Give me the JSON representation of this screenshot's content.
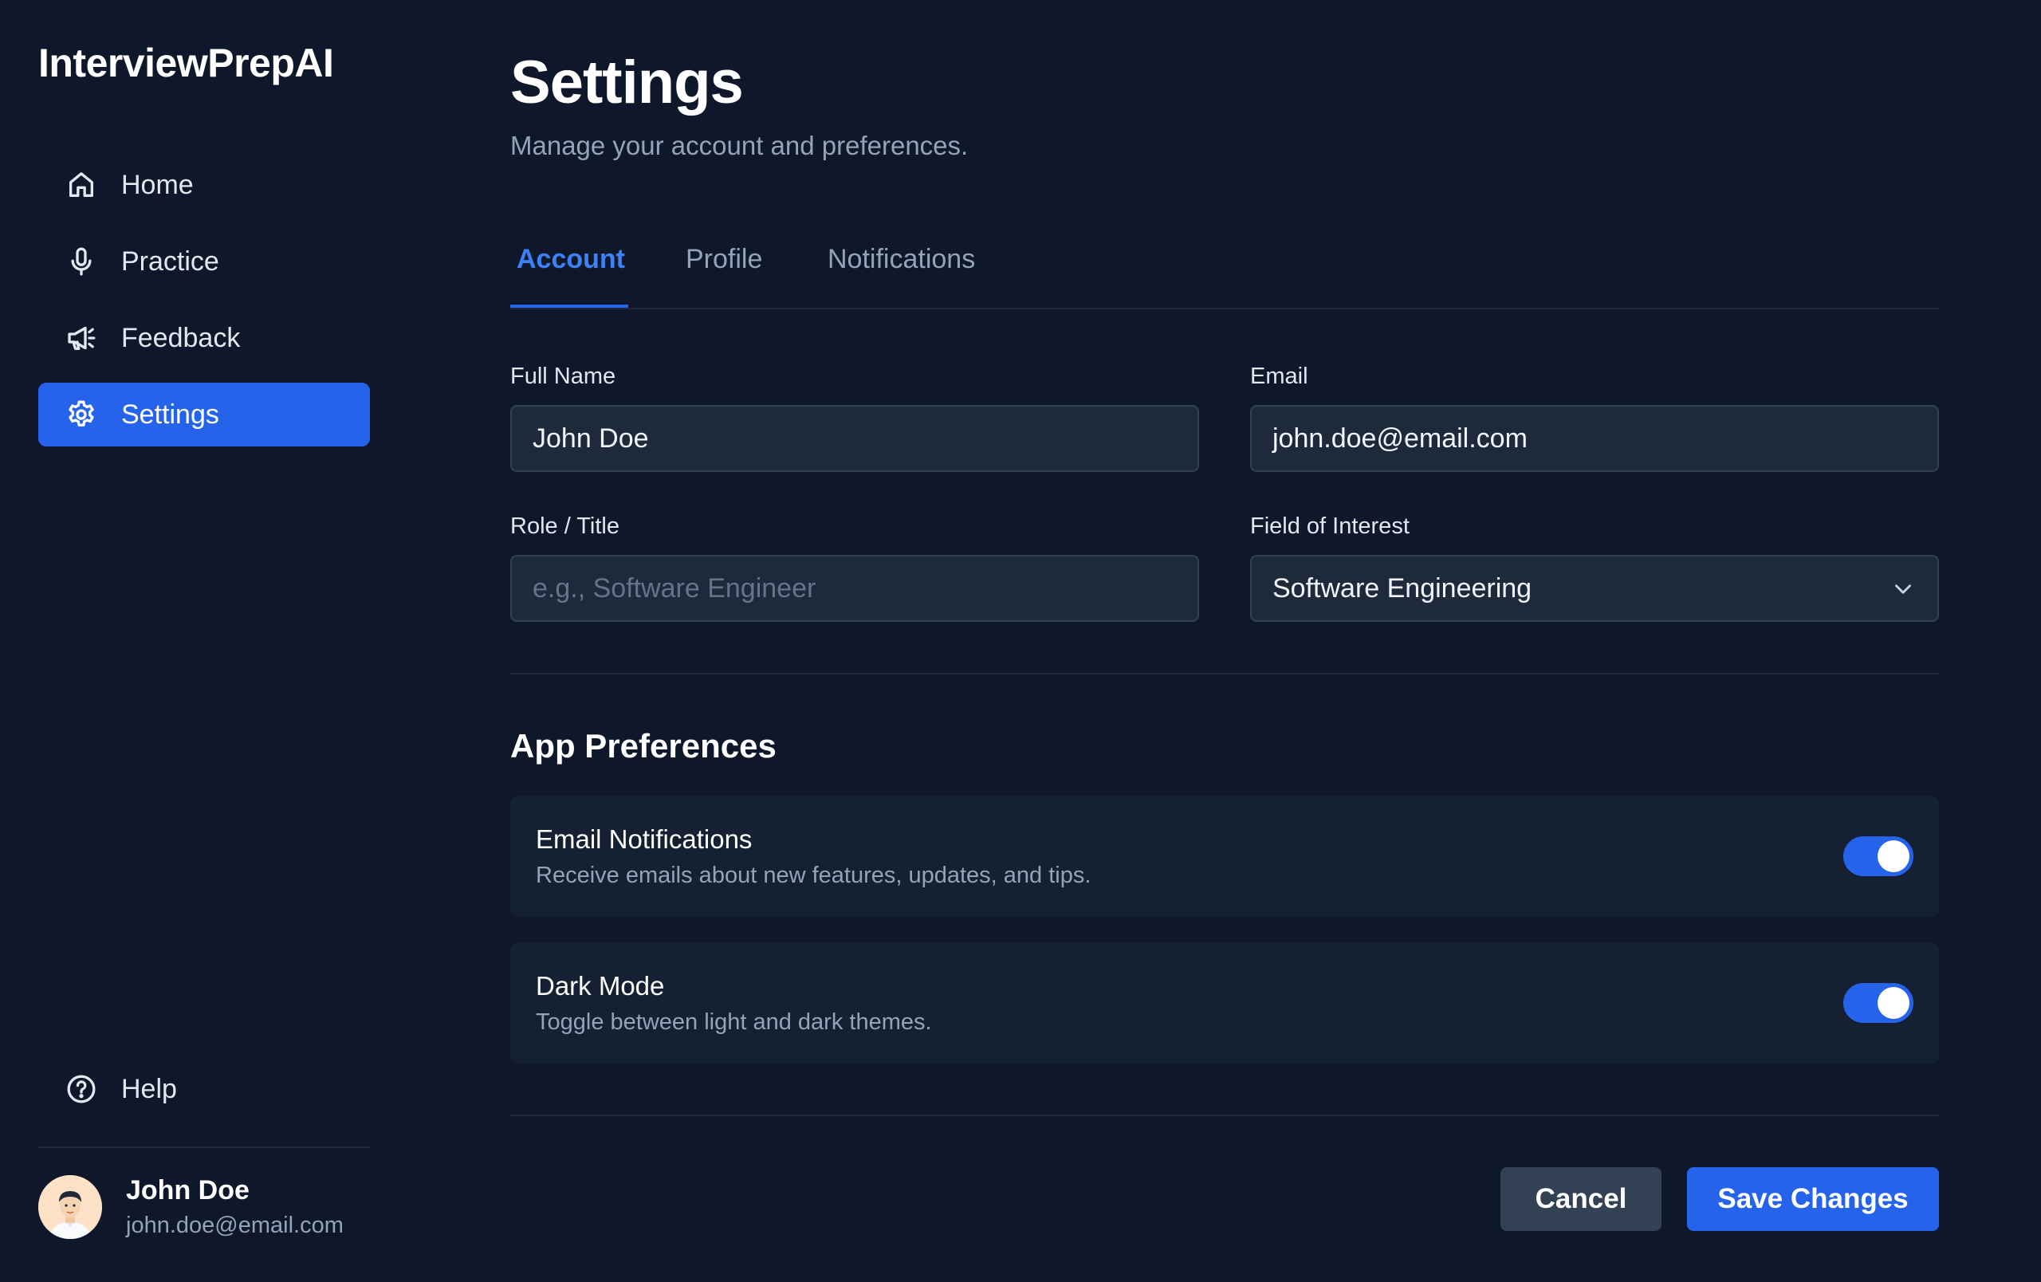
{
  "app": {
    "name": "InterviewPrepAI"
  },
  "sidebar": {
    "items": [
      {
        "label": "Home",
        "icon": "home-icon"
      },
      {
        "label": "Practice",
        "icon": "microphone-icon"
      },
      {
        "label": "Feedback",
        "icon": "megaphone-icon"
      },
      {
        "label": "Settings",
        "icon": "gear-icon",
        "active": true
      }
    ],
    "help": {
      "label": "Help",
      "icon": "help-circle-icon"
    },
    "user": {
      "name": "John Doe",
      "email": "john.doe@email.com"
    }
  },
  "header": {
    "title": "Settings",
    "subtitle": "Manage your account and preferences."
  },
  "tabs": [
    {
      "label": "Account",
      "active": true
    },
    {
      "label": "Profile"
    },
    {
      "label": "Notifications"
    }
  ],
  "form": {
    "full_name": {
      "label": "Full Name",
      "value": "John Doe"
    },
    "email": {
      "label": "Email",
      "value": "john.doe@email.com"
    },
    "role": {
      "label": "Role / Title",
      "value": "",
      "placeholder": "e.g., Software Engineer"
    },
    "field_of_interest": {
      "label": "Field of Interest",
      "value": "Software Engineering"
    }
  },
  "preferences": {
    "title": "App Preferences",
    "items": [
      {
        "title": "Email Notifications",
        "description": "Receive emails about new features, updates, and tips.",
        "enabled": true
      },
      {
        "title": "Dark Mode",
        "description": "Toggle between light and dark themes.",
        "enabled": true
      }
    ]
  },
  "actions": {
    "cancel": "Cancel",
    "save": "Save Changes"
  },
  "colors": {
    "accent": "#2563eb",
    "background": "#0f172a",
    "surface": "#1e293b"
  }
}
